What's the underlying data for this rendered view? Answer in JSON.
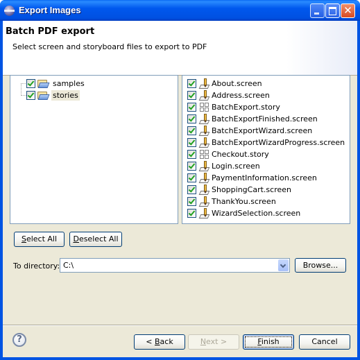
{
  "window": {
    "title": "Export Images",
    "controls": {
      "minimize": "minimize",
      "maximize": "maximize",
      "close": "✕"
    }
  },
  "header": {
    "title": "Batch PDF export",
    "description": "Select screen and storyboard files to export to PDF"
  },
  "folder_tree": [
    {
      "label": "samples",
      "checked": true,
      "icon": "folder-open-icon",
      "selected": false
    },
    {
      "label": "stories",
      "checked": true,
      "icon": "folder-open-icon",
      "selected": true
    }
  ],
  "file_list": [
    {
      "label": "About.screen",
      "checked": true,
      "type": "screen"
    },
    {
      "label": "Address.screen",
      "checked": true,
      "type": "screen"
    },
    {
      "label": "BatchExport.story",
      "checked": true,
      "type": "story"
    },
    {
      "label": "BatchExportFinished.screen",
      "checked": true,
      "type": "screen"
    },
    {
      "label": "BatchExportWizard.screen",
      "checked": true,
      "type": "screen"
    },
    {
      "label": "BatchExportWizardProgress.screen",
      "checked": true,
      "type": "screen"
    },
    {
      "label": "Checkout.story",
      "checked": true,
      "type": "story"
    },
    {
      "label": "Login.screen",
      "checked": true,
      "type": "screen"
    },
    {
      "label": "PaymentInformation.screen",
      "checked": true,
      "type": "screen"
    },
    {
      "label": "ShoppingCart.screen",
      "checked": true,
      "type": "screen"
    },
    {
      "label": "ThankYou.screen",
      "checked": true,
      "type": "screen"
    },
    {
      "label": "WizardSelection.screen",
      "checked": true,
      "type": "screen"
    }
  ],
  "selection_buttons": {
    "select_all": {
      "mnemonic": "S",
      "rest": "elect All"
    },
    "deselect_all": {
      "mnemonic": "D",
      "rest": "eselect All"
    }
  },
  "directory": {
    "label": "To directory:",
    "value": "C:\\",
    "browse": "Browse..."
  },
  "footer": {
    "help_icon": "?",
    "back": {
      "prefix": "< ",
      "mnemonic": "B",
      "rest": "ack",
      "enabled": true
    },
    "next": {
      "mnemonic": "N",
      "rest": "ext >",
      "enabled": false
    },
    "finish": {
      "mnemonic": "F",
      "rest": "inish",
      "enabled": true,
      "default": true
    },
    "cancel": "Cancel"
  }
}
